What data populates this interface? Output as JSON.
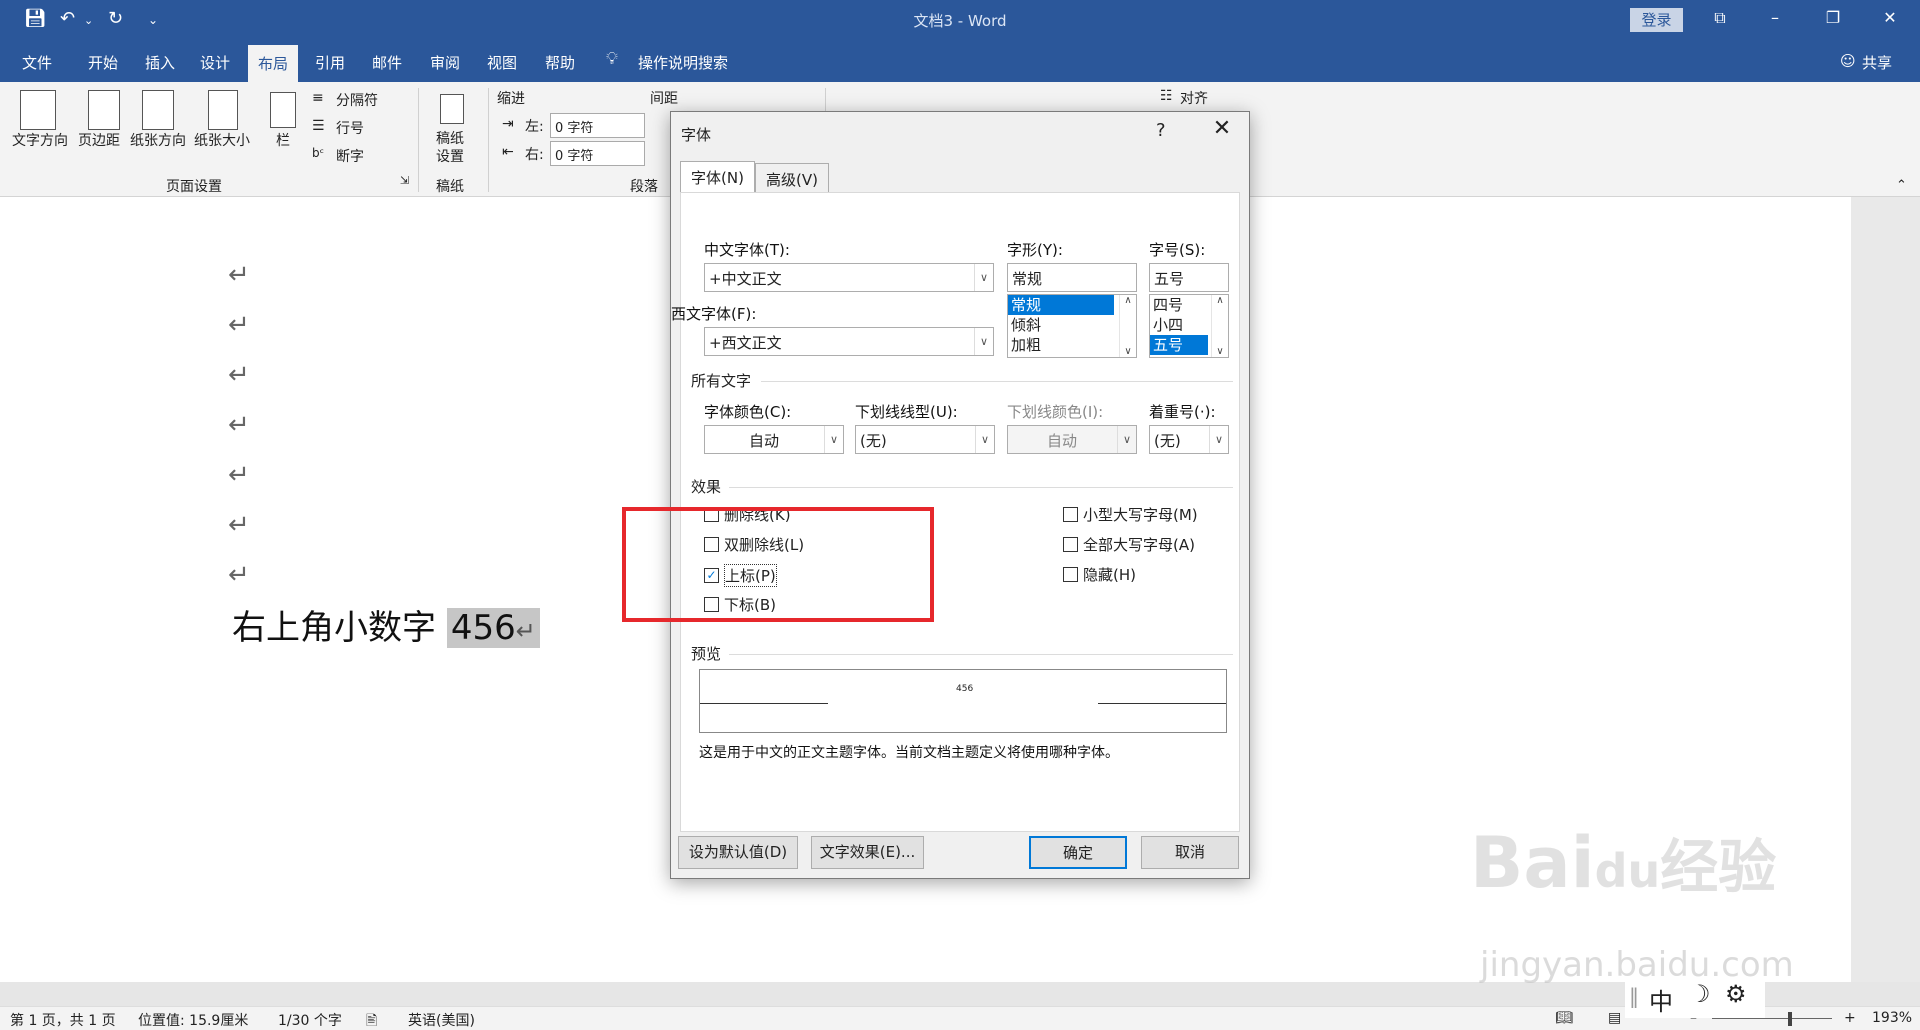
{
  "titlebar": {
    "document_title": "文档3  -  Word",
    "login": "登录",
    "save_icon": "save-icon",
    "undo_icon": "undo-icon",
    "redo_icon": "redo-icon"
  },
  "tabs": [
    "文件",
    "开始",
    "插入",
    "设计",
    "布局",
    "引用",
    "邮件",
    "审阅",
    "视图",
    "帮助"
  ],
  "active_tab": "布局",
  "tell_me": "操作说明搜索",
  "share": "共享",
  "ribbon": {
    "text_direction": "文字方向",
    "margins": "页边距",
    "orientation": "纸张方向",
    "size": "纸张大小",
    "columns": "栏",
    "breaks": "分隔符",
    "line_numbers": "行号",
    "hyphenation": "断字",
    "page_setup_group": "页面设置",
    "manuscript": "稿纸设置",
    "manuscript_group": "稿纸",
    "indent_label": "缩进",
    "spacing_label": "间距",
    "indent_left": "左:",
    "indent_right": "右:",
    "indent_left_value": "0 字符",
    "indent_right_value": "0 字符",
    "paragraph_group": "段落",
    "align": "对齐"
  },
  "document": {
    "line_text": "右上角小数字",
    "selected_text": "456"
  },
  "statusbar": {
    "page": "第 1 页，共 1 页",
    "position": "位置值: 15.9厘米",
    "words": "1/30 个字",
    "language": "英语(美国)",
    "zoom": "193%"
  },
  "ime": {
    "mode": "中"
  },
  "dialog": {
    "title": "字体",
    "help": "?",
    "tab_font": "字体(N)",
    "tab_advanced": "高级(V)",
    "cn_font_label": "中文字体(T):",
    "cn_font_value": "+中文正文",
    "west_font_label": "西文字体(F):",
    "west_font_value": "+西文正文",
    "style_label": "字形(Y):",
    "style_value": "常规",
    "style_options": [
      "常规",
      "倾斜",
      "加粗"
    ],
    "size_label": "字号(S):",
    "size_value": "五号",
    "size_options": [
      "四号",
      "小四",
      "五号"
    ],
    "all_text_group": "所有文字",
    "color_label": "字体颜色(C):",
    "color_value": "自动",
    "underline_label": "下划线线型(U):",
    "underline_value": "(无)",
    "underline_color_label": "下划线颜色(I):",
    "underline_color_value": "自动",
    "emphasis_label": "着重号(·):",
    "emphasis_value": "(无)",
    "effects_group": "效果",
    "strikethrough": "删除线(K)",
    "double_strikethrough": "双删除线(L)",
    "superscript": "上标(P)",
    "subscript": "下标(B)",
    "small_caps": "小型大写字母(M)",
    "all_caps": "全部大写字母(A)",
    "hidden": "隐藏(H)",
    "preview_group": "预览",
    "preview_text": "456",
    "preview_desc": "这是用于中文的正文主题字体。当前文档主题定义将使用哪种字体。",
    "set_default": "设为默认值(D)",
    "text_effects": "文字效果(E)...",
    "ok": "确定",
    "cancel": "取消"
  },
  "watermark": {
    "brand": "Bai",
    "brand2": "du",
    "brand_cn": "经验",
    "site": "jingyan.baidu.com"
  }
}
